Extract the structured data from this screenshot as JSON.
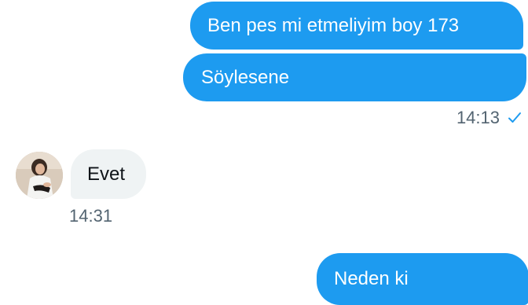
{
  "conversation": {
    "messages": [
      {
        "direction": "outgoing",
        "text": "Ben pes mi etmeliyim boy 173"
      },
      {
        "direction": "outgoing",
        "text": "Söylesene"
      },
      {
        "direction": "incoming",
        "text": "Evet"
      },
      {
        "direction": "outgoing",
        "text": "Neden ki"
      }
    ],
    "timestamps": {
      "sent": "14:13",
      "received": "14:31"
    },
    "status_icon": "check-icon",
    "contact_avatar": "avatar-photo"
  },
  "colors": {
    "outgoing_bubble": "#1d9bf0",
    "incoming_bubble": "#eff3f4",
    "timestamp": "#536471",
    "check": "#1d9bf0"
  }
}
